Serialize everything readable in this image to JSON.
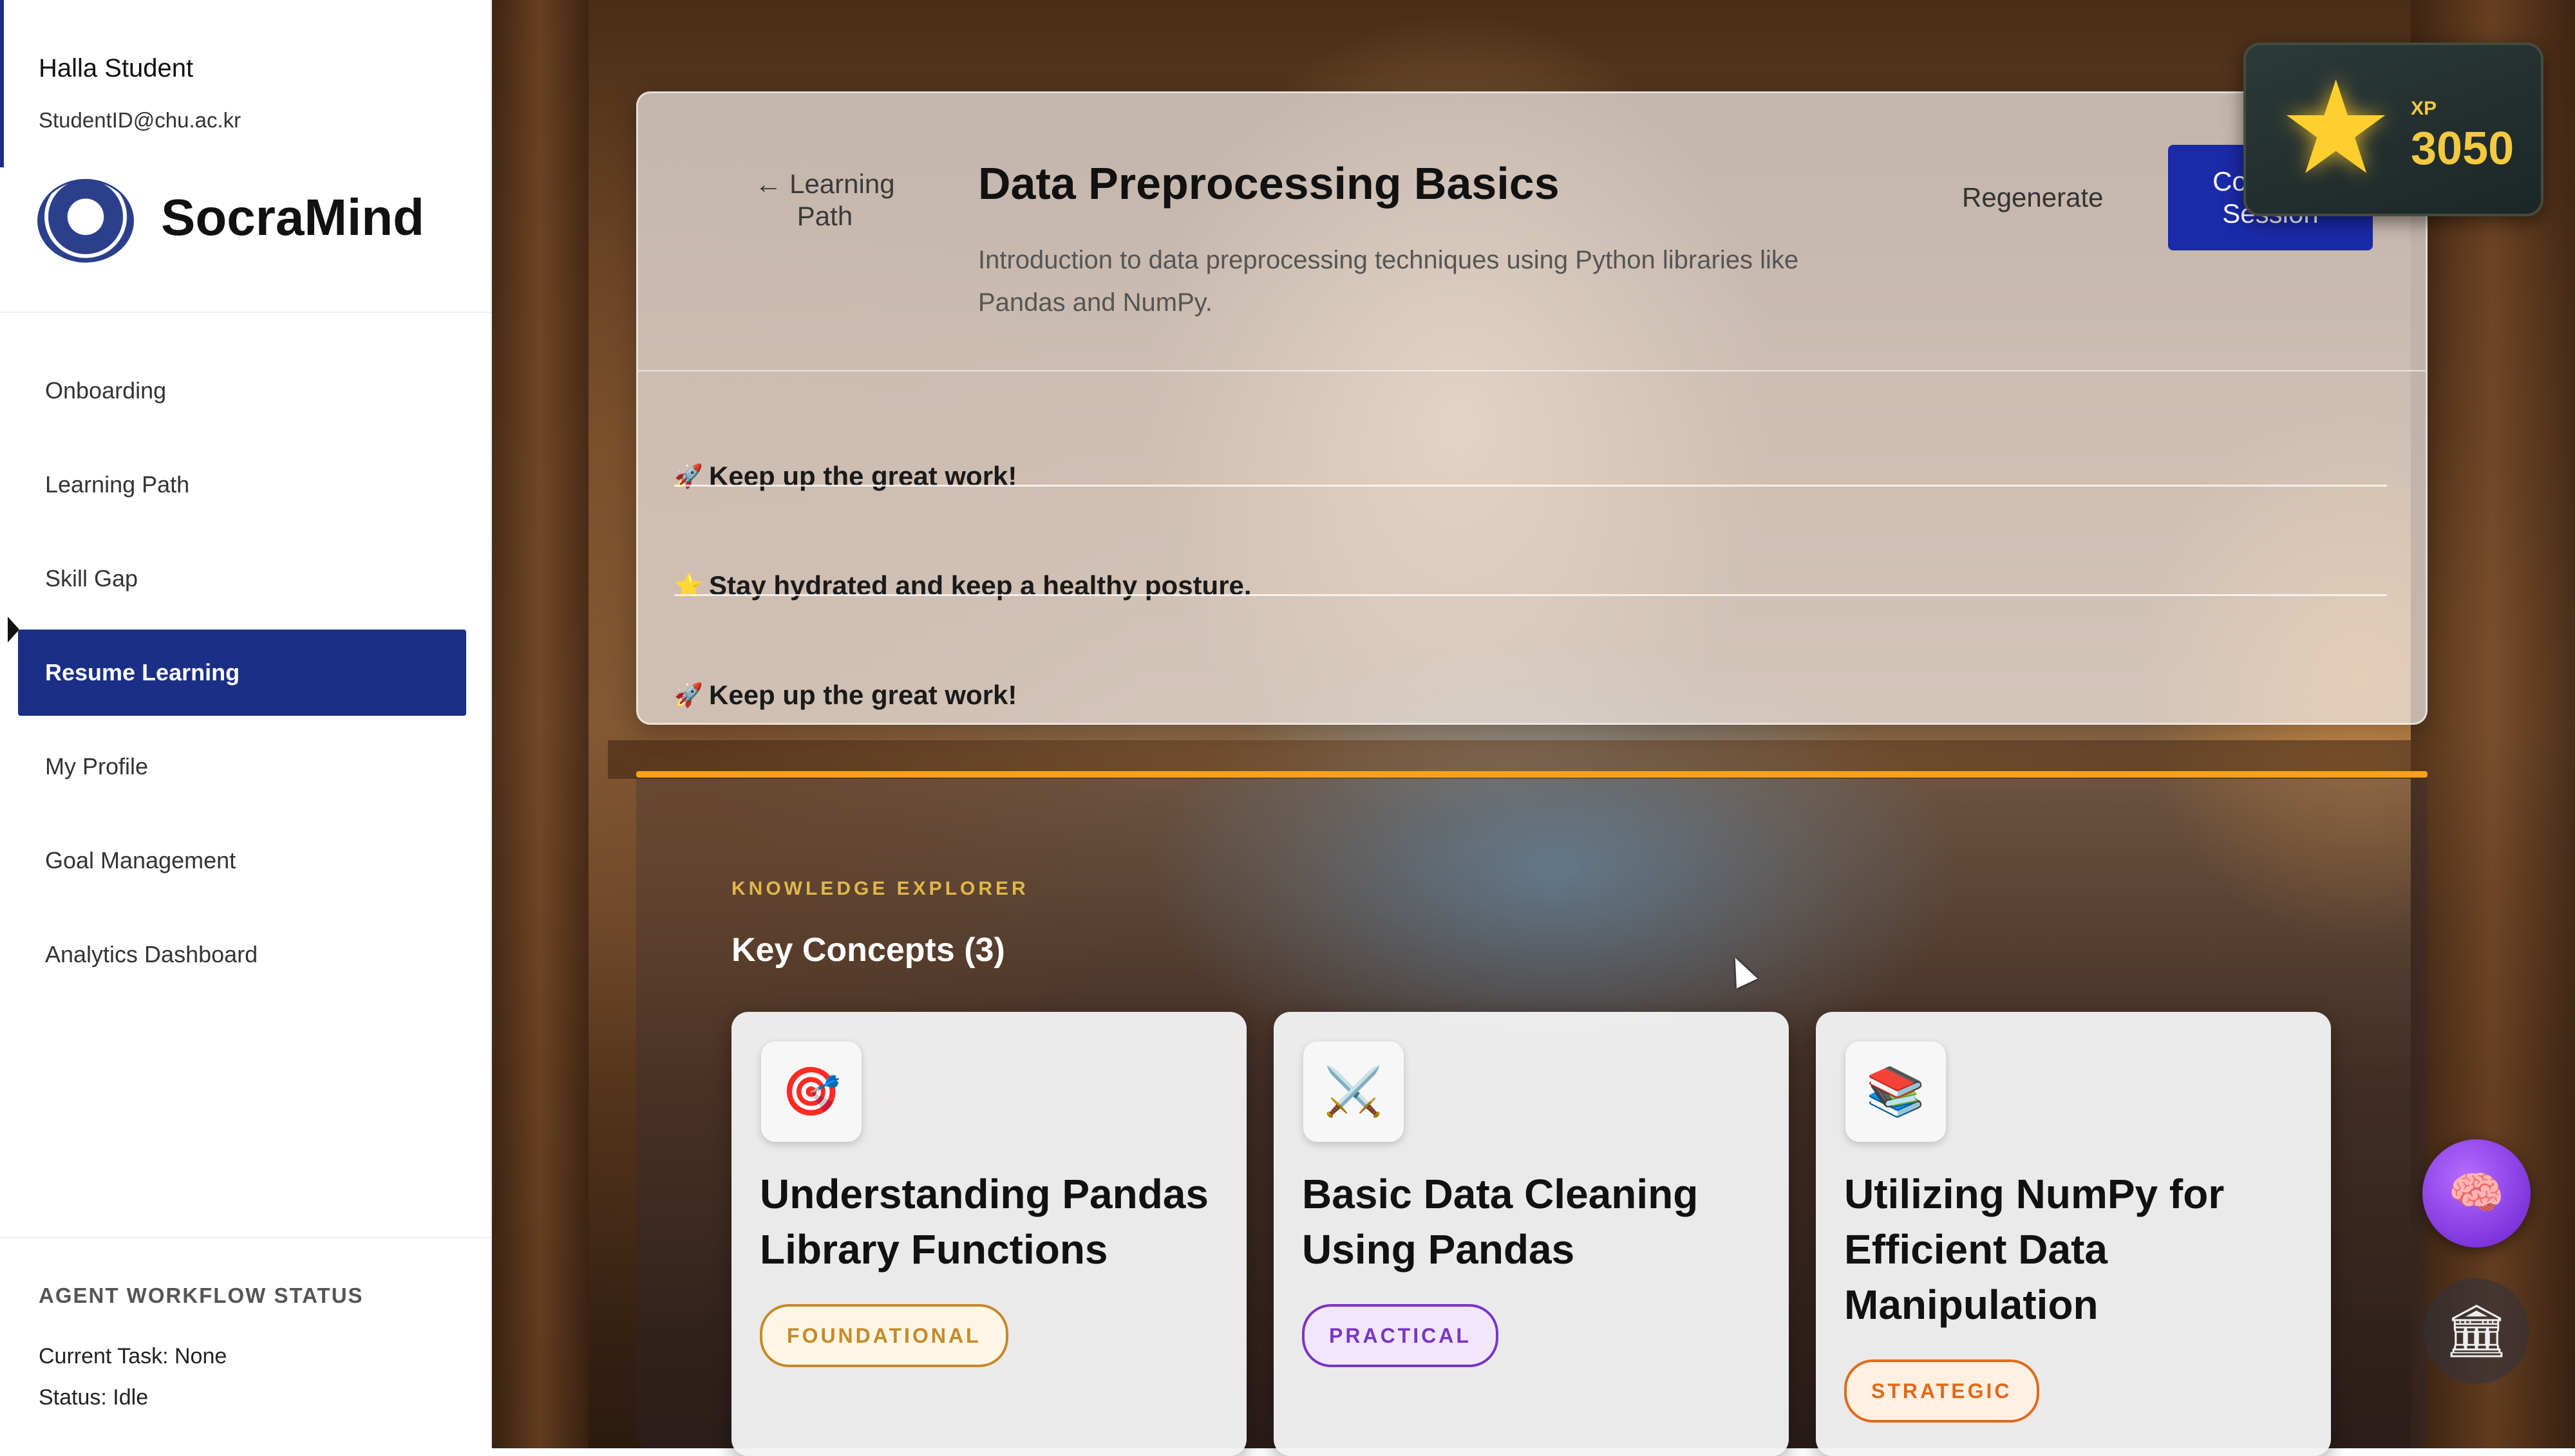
{
  "user": {
    "name": "Halla Student",
    "email": "StudentID@chu.ac.kr"
  },
  "brand": {
    "name": "SocraMind",
    "logo_icon": "university-seal-icon"
  },
  "nav": {
    "items": [
      {
        "label": "Onboarding"
      },
      {
        "label": "Learning Path"
      },
      {
        "label": "Skill Gap"
      },
      {
        "label": "Resume Learning",
        "active": true
      },
      {
        "label": "My Profile"
      },
      {
        "label": "Goal Management"
      },
      {
        "label": "Analytics Dashboard"
      }
    ]
  },
  "workflow": {
    "title": "AGENT WORKFLOW STATUS",
    "current_task": "Current Task: None",
    "status": "Status: Idle"
  },
  "header": {
    "back_label": "← Learning Path",
    "title": "Data Preprocessing Basics",
    "description": "Introduction to data preprocessing techniques using Python libraries like Pandas and NumPy.",
    "regenerate_label": "Regenerate",
    "complete_label": "Complete Session"
  },
  "tips": [
    {
      "icon": "🚀",
      "text": "Keep up the great work!"
    },
    {
      "icon": "⭐",
      "text": "Stay hydrated and keep a healthy posture."
    },
    {
      "icon": "🚀",
      "text": "Keep up the great work!"
    }
  ],
  "xp": {
    "label": "XP",
    "value": "3050",
    "icon": "star-icon"
  },
  "knowledge": {
    "label": "KNOWLEDGE EXPLORER",
    "title": "Key Concepts (3)",
    "cards": [
      {
        "icon": "🎯",
        "title": "Understanding Pandas Library Functions",
        "tag": "FOUNDATIONAL"
      },
      {
        "icon": "⚔️",
        "title": "Basic Data Cleaning Using Pandas",
        "tag": "PRACTICAL"
      },
      {
        "icon": "📚",
        "title": "Utilizing NumPy for Efficient Data Manipulation",
        "tag": "STRATEGIC"
      }
    ]
  },
  "colors": {
    "nav_active": "#1b2f86",
    "complete_button": "#1b2aa8",
    "xp_gold": "#f3c940",
    "accent_orange": "#f5a21a"
  }
}
